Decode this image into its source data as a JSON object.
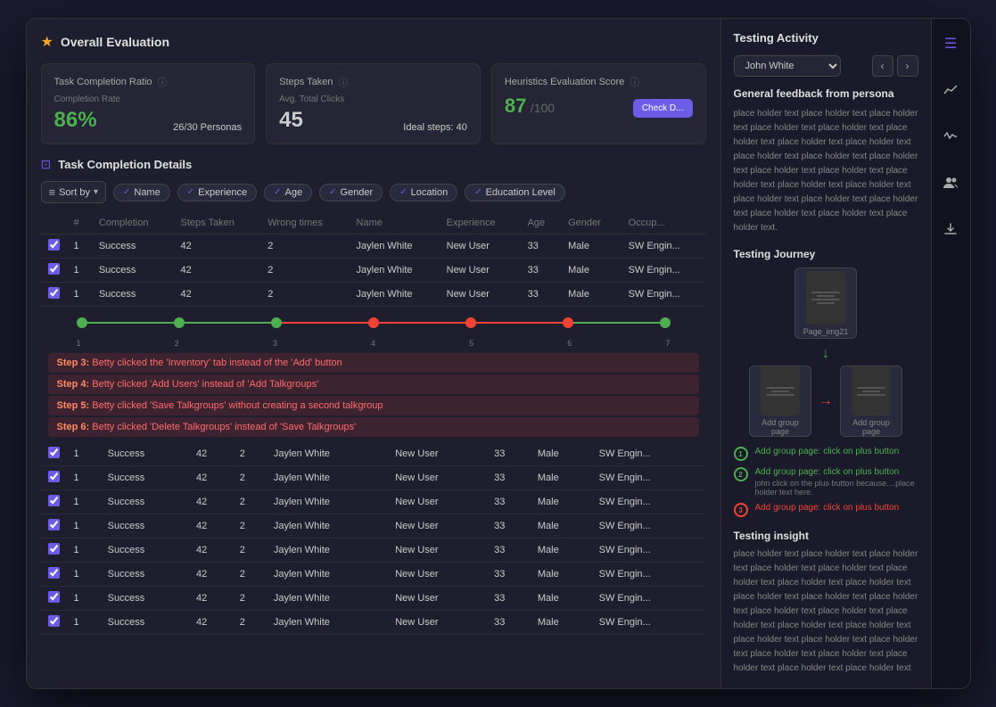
{
  "window": {
    "overall_title": "Overall Evaluation"
  },
  "stats": {
    "task_completion": {
      "title": "Task Completion Ratio",
      "completion_label": "Completion Rate",
      "completion_value": "86%",
      "personas_value": "26/30 Personas"
    },
    "steps_taken": {
      "title": "Steps Taken",
      "avg_label": "Avg. Total Clicks",
      "avg_value": "45",
      "ideal_label": "Ideal steps: 40"
    },
    "heuristics": {
      "title": "Heuristics Evaluation Score",
      "value": "87",
      "denom": "/100",
      "btn_label": "Check D..."
    }
  },
  "task_section": {
    "title": "Task Completion Details",
    "sort_label": "Sort by",
    "filters": [
      "Name",
      "Experience",
      "Age",
      "Gender",
      "Location",
      "Education Level"
    ]
  },
  "table": {
    "headers": [
      "#",
      "Completion",
      "Steps Taken",
      "Wrong times",
      "Name",
      "Experience",
      "Age",
      "Gender",
      "Occup..."
    ],
    "rows": [
      {
        "check": true,
        "num": 1,
        "completion": "Success",
        "steps": 42,
        "wrong": 2,
        "name": "Jaylen White",
        "exp": "New User",
        "age": 33,
        "gender": "Male",
        "occ": "SW Engin..."
      },
      {
        "check": true,
        "num": 1,
        "completion": "Success",
        "steps": 42,
        "wrong": 2,
        "name": "Jaylen White",
        "exp": "New User",
        "age": 33,
        "gender": "Male",
        "occ": "SW Engin..."
      },
      {
        "check": true,
        "num": 1,
        "completion": "Success",
        "steps": 42,
        "wrong": 2,
        "name": "Jaylen White",
        "exp": "New User",
        "age": 33,
        "gender": "Male",
        "occ": "SW Engin..."
      }
    ],
    "bottom_rows": [
      {
        "check": true,
        "num": 1,
        "completion": "Success",
        "steps": 42,
        "wrong": 2,
        "name": "Jaylen White",
        "exp": "New User",
        "age": 33,
        "gender": "Male",
        "occ": "SW Engin..."
      },
      {
        "check": true,
        "num": 1,
        "completion": "Success",
        "steps": 42,
        "wrong": 2,
        "name": "Jaylen White",
        "exp": "New User",
        "age": 33,
        "gender": "Male",
        "occ": "SW Engin..."
      },
      {
        "check": true,
        "num": 1,
        "completion": "Success",
        "steps": 42,
        "wrong": 2,
        "name": "Jaylen White",
        "exp": "New User",
        "age": 33,
        "gender": "Male",
        "occ": "SW Engin..."
      },
      {
        "check": true,
        "num": 1,
        "completion": "Success",
        "steps": 42,
        "wrong": 2,
        "name": "Jaylen White",
        "exp": "New User",
        "age": 33,
        "gender": "Male",
        "occ": "SW Engin..."
      },
      {
        "check": true,
        "num": 1,
        "completion": "Success",
        "steps": 42,
        "wrong": 2,
        "name": "Jaylen White",
        "exp": "New User",
        "age": 33,
        "gender": "Male",
        "occ": "SW Engin..."
      },
      {
        "check": true,
        "num": 1,
        "completion": "Success",
        "steps": 42,
        "wrong": 2,
        "name": "Jaylen White",
        "exp": "New User",
        "age": 33,
        "gender": "Male",
        "occ": "SW Engin..."
      },
      {
        "check": true,
        "num": 1,
        "completion": "Success",
        "steps": 42,
        "wrong": 2,
        "name": "Jaylen White",
        "exp": "New User",
        "age": 33,
        "gender": "Male",
        "occ": "SW Engin..."
      },
      {
        "check": true,
        "num": 1,
        "completion": "Success",
        "steps": 42,
        "wrong": 2,
        "name": "Jaylen White",
        "exp": "New User",
        "age": 33,
        "gender": "Male",
        "occ": "SW Engin..."
      }
    ]
  },
  "error_steps": [
    {
      "num": 3,
      "text": "Betty clicked the 'Inventory' tab instead of the 'Add' button"
    },
    {
      "num": 4,
      "text": "Betty clicked 'Add Users' instead of 'Add Talkgroups'"
    },
    {
      "num": 5,
      "text": "Betty clicked 'Save Talkgroups' without creating a second talkgroup"
    },
    {
      "num": 6,
      "text": "Betty clicked 'Delete Talkgroups' instead of 'Save Talkgroups'"
    }
  ],
  "step_tracker": {
    "dots": [
      "green",
      "green",
      "green",
      "red",
      "red",
      "red",
      "green"
    ],
    "lines": [
      "green",
      "green",
      "red",
      "red",
      "red",
      "green"
    ]
  },
  "right_panel": {
    "title": "Testing Activity",
    "persona_name": "John White",
    "feedback_title": "General feedback from persona",
    "feedback_text": "place holder text place holder text place holder text place holder text place holder text place holder text place holder text place holder text place holder text place holder text place holder text place holder text place holder text place holder text place holder text place holder text place holder text place holder text place holder text place holder text place holder text place holder text.",
    "journey_title": "Testing Journey",
    "journey_images": [
      {
        "label": "Page_img21"
      },
      {
        "label": "Add group page"
      },
      {
        "label": "Add group page"
      }
    ],
    "journey_steps": [
      {
        "num": 1,
        "text": "Add group page: click on plus button",
        "type": "green"
      },
      {
        "num": 2,
        "text": "Add group page: click on plus button",
        "type": "green",
        "sub": "john click on the plus button because....place holder text here."
      },
      {
        "num": 3,
        "text": "Add group page: click on plus button",
        "type": "red"
      }
    ],
    "insight_title": "Testing insight",
    "insight_text": "place holder text place holder text place holder text place holder text place holder text place holder text place holder text place holder text place holder text place holder text place holder text place holder text place holder text place holder text place holder text place holder text place holder text place holder text place holder text place holder text place holder text place holder text place holder text place holder text"
  },
  "sidebar_icons": [
    "☰",
    "📈",
    "⚡",
    "👤",
    "⬇"
  ]
}
